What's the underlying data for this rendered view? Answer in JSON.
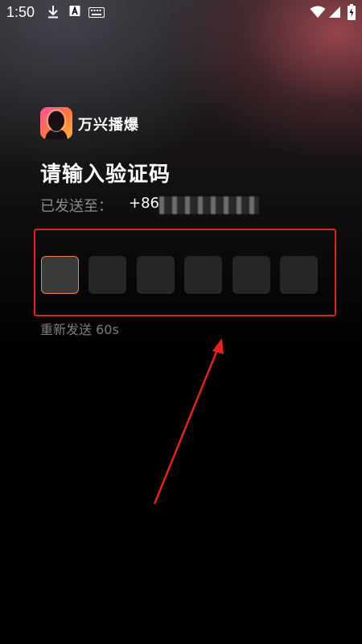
{
  "status_bar": {
    "time": "1:50",
    "icons": [
      "download-icon",
      "a-icon",
      "keyboard-icon",
      "wifi-icon",
      "cell-signal-icon",
      "battery-charging-icon"
    ]
  },
  "app": {
    "name": "万兴播爆",
    "logo_icon": "app-logo-icon"
  },
  "page": {
    "title": "请输入验证码",
    "sent_label": "已发送至：",
    "phone_prefix": "+86"
  },
  "code_input": {
    "digits": [
      "",
      "",
      "",
      "",
      "",
      ""
    ],
    "active_index": 0,
    "highlight_color": "#e0251d"
  },
  "resend": {
    "label": "重新发送 60s"
  },
  "colors": {
    "accent": "#e8834a",
    "annotation": "#e0251d",
    "muted_text": "#8a8a8a"
  }
}
